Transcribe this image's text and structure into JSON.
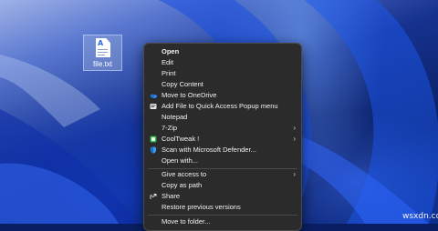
{
  "desktop": {
    "file": {
      "name": "file.txt",
      "icon": "text-document-icon"
    }
  },
  "context_menu": {
    "items": [
      {
        "label": "Open",
        "bold": true
      },
      {
        "label": "Edit"
      },
      {
        "label": "Print"
      },
      {
        "label": "Copy Content"
      },
      {
        "label": "Move to OneDrive",
        "icon": "onedrive-icon"
      },
      {
        "label": "Add File to Quick Access Popup menu",
        "icon": "quick-access-icon"
      },
      {
        "label": "Notepad"
      },
      {
        "label": "7-Zip",
        "submenu": true
      },
      {
        "label": "CoolTweak !",
        "icon": "cooltweak-icon",
        "submenu": true
      },
      {
        "label": "Scan with Microsoft Defender...",
        "icon": "defender-shield-icon"
      },
      {
        "label": "Open with..."
      },
      {
        "label": "Give access to",
        "submenu": true
      },
      {
        "label": "Copy as path"
      },
      {
        "label": "Share",
        "icon": "share-icon"
      },
      {
        "label": "Restore previous versions"
      },
      {
        "label": "Move to folder..."
      }
    ]
  },
  "watermark": "wsxdn.com",
  "colors": {
    "menu_bg": "#2b2b2b",
    "menu_text": "#f2f2f2",
    "onedrive": "#2f8cff",
    "defender": "#3d9cf0",
    "cooltweak": "#37b24d"
  }
}
